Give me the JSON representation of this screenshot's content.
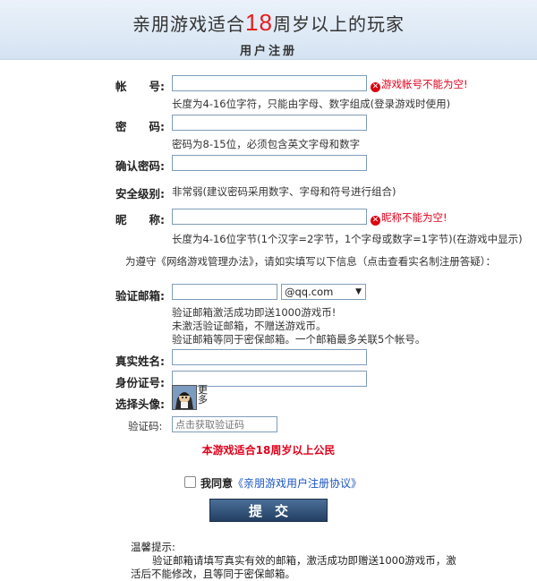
{
  "header": {
    "title_pre": "亲朋游戏适合",
    "title_num": "18",
    "title_post": "周岁以上的玩家",
    "subtitle": "用户注册"
  },
  "form": {
    "account": {
      "label": "帐　　号:",
      "error": "游戏帐号不能为空!",
      "hint": "长度为4-16位字符，只能由字母、数字组成(登录游戏时使用)"
    },
    "password": {
      "label": "密　　码:",
      "hint": "密码为8-15位，必须包含英文字母和数字"
    },
    "confirm": {
      "label": "确认密码:"
    },
    "security": {
      "label": "安全级别:",
      "value": "非常弱(建议密码采用数字、字母和符号进行组合)"
    },
    "nickname": {
      "label": "昵　　称:",
      "error": "昵称不能为空!",
      "hint": "长度为4-16位字节(1个汉字=2字节，1个字母或数字=1字节)(在游戏中显示)"
    },
    "law_notice": "为遵守《网络游戏管理办法》，请如实填写以下信息（点击查看实名制注册答疑）：",
    "email": {
      "label": "验证邮箱:",
      "domain": "@qq.com",
      "hint1": "验证邮箱激活成功即送1000游戏币!",
      "hint2": "未激活验证邮箱，不赠送游戏币。",
      "hint3": "验证邮箱等同于密保邮箱。一个邮箱最多关联5个帐号。"
    },
    "realname": {
      "label": "真实姓名:"
    },
    "idcard": {
      "label": "身份证号:"
    },
    "avatar": {
      "label": "选择头像:",
      "more": "更多"
    },
    "captcha": {
      "label": "验证码:",
      "placeholder": "点击获取验证码"
    },
    "age_notice": "本游戏适合18周岁以上公民",
    "agree_text": "我同意",
    "agree_link": "《亲朋游戏用户注册协议》",
    "submit": "提交",
    "tips_title": "温馨提示:",
    "tips_line1": "验证邮箱请填写真实有效的邮箱，激活成功即赠送1000游戏币，激",
    "tips_line2": "活后不能修改，且等同于密保邮箱。"
  },
  "colors": {
    "error": "#e0001b",
    "link": "#1a55c3",
    "button": "#2c4a70"
  }
}
